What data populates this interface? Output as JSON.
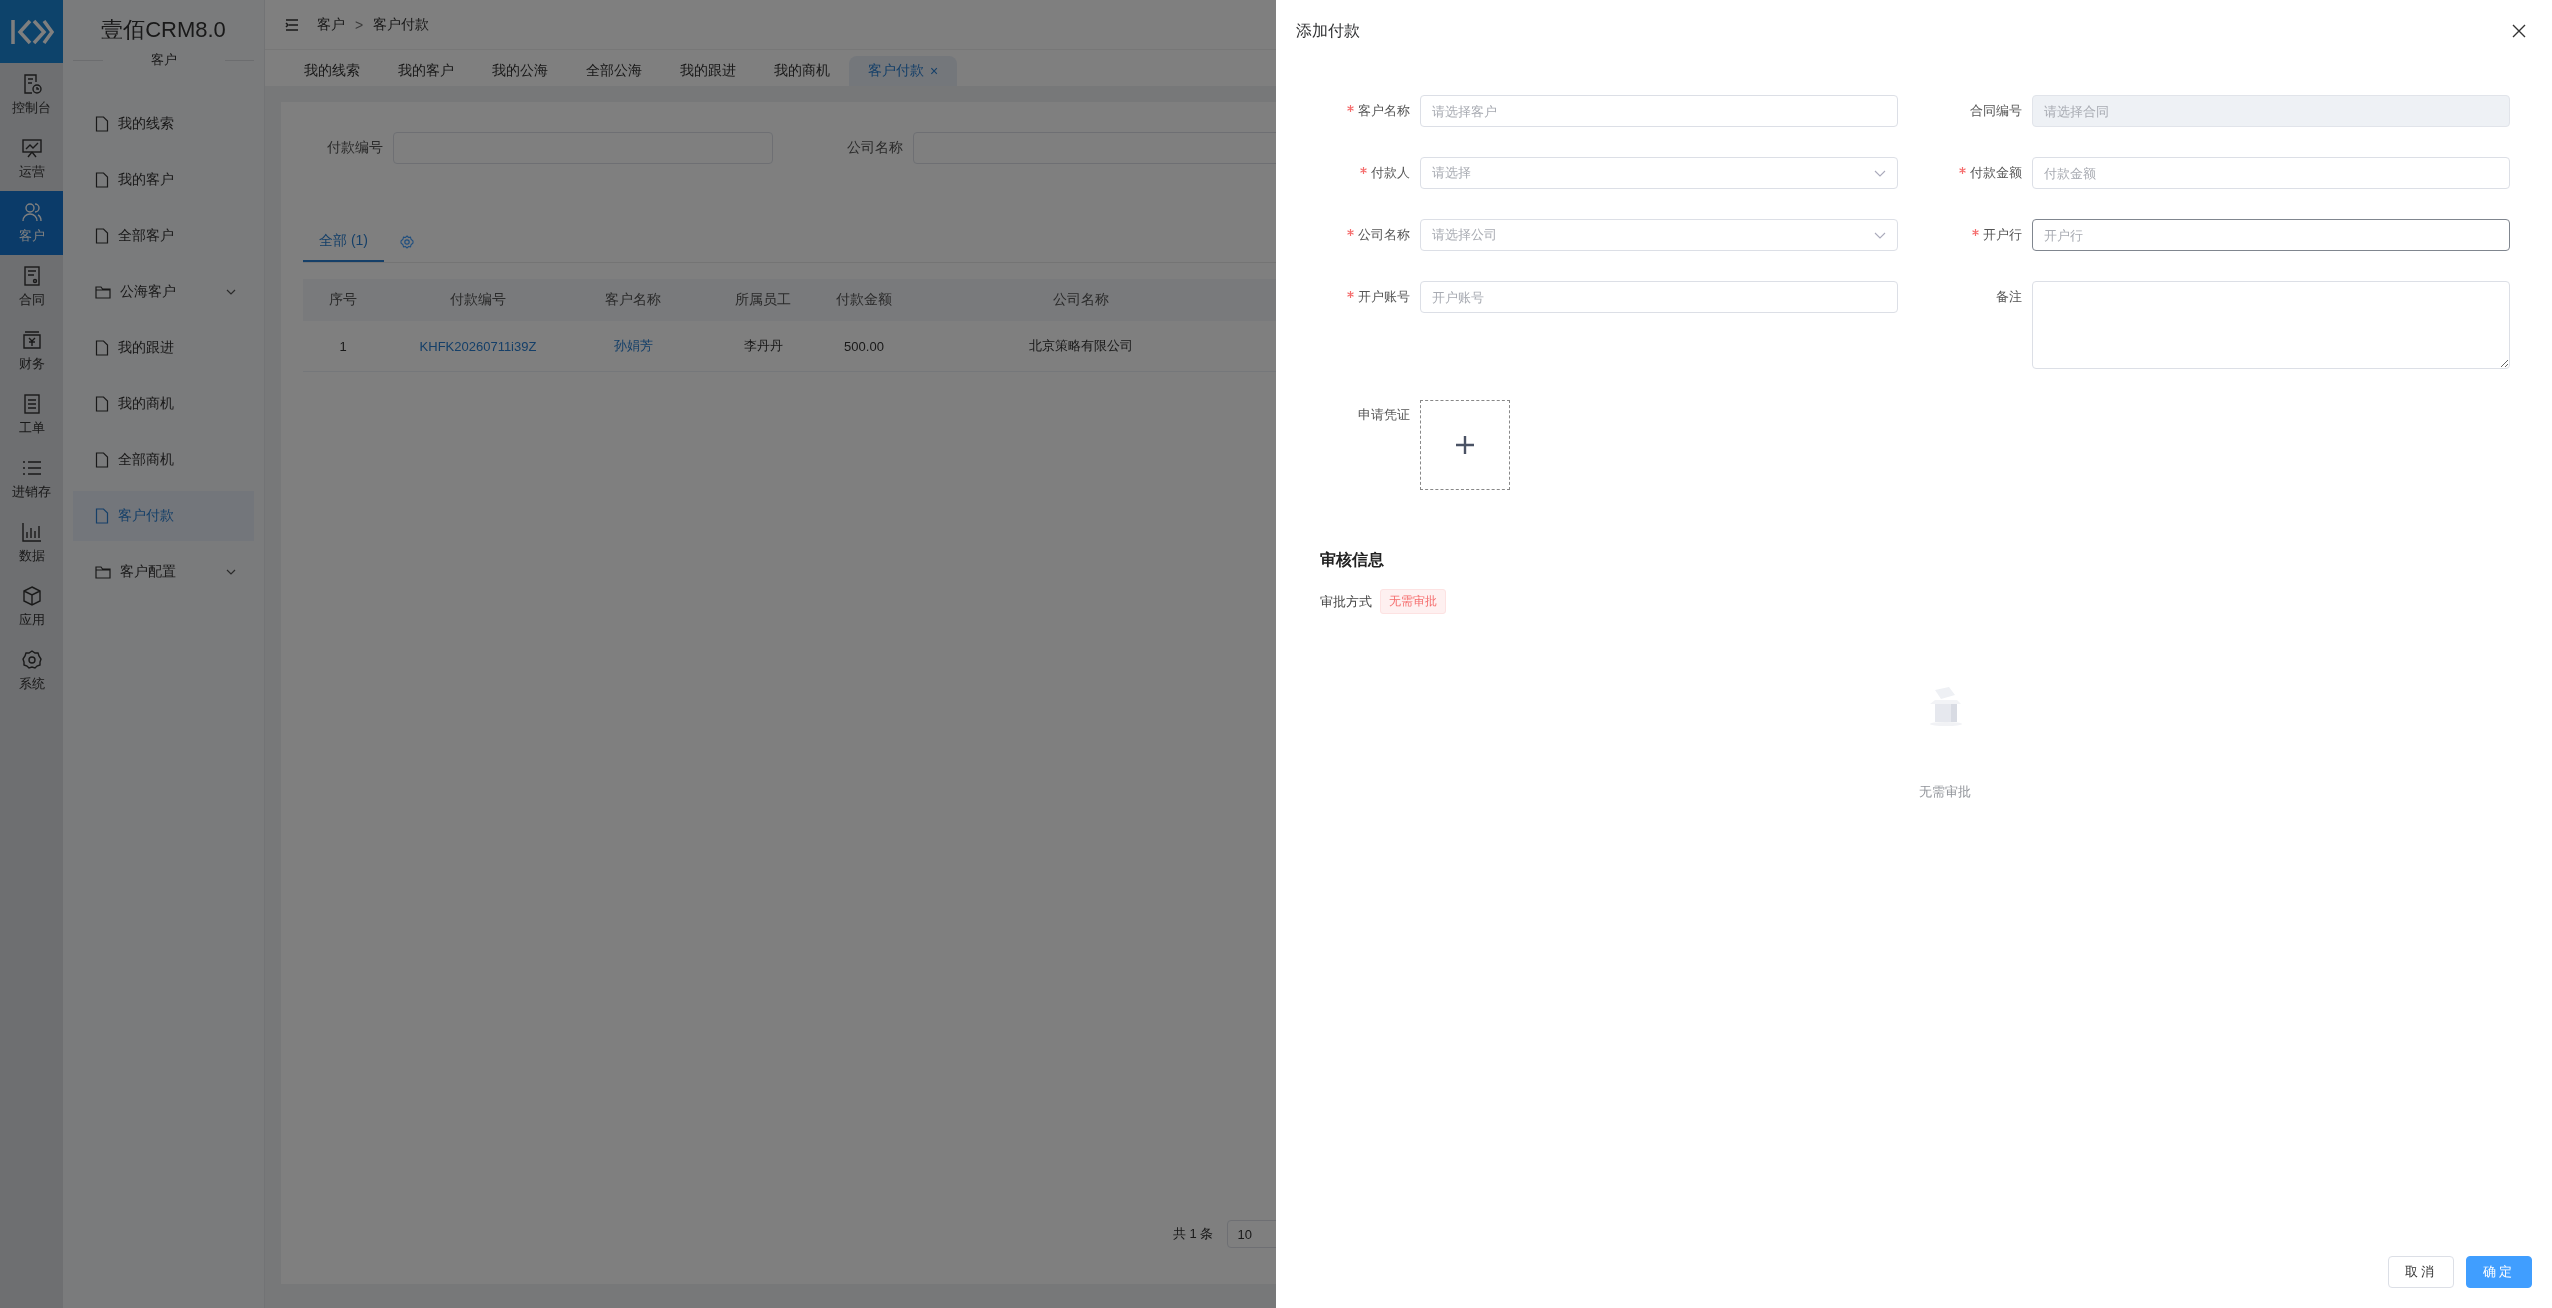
{
  "nav_rail": {
    "items": [
      {
        "label": "控制台",
        "kind": "dashboard",
        "selected": false
      },
      {
        "label": "运营",
        "kind": "presentation",
        "selected": false
      },
      {
        "label": "客户",
        "kind": "users",
        "selected": true
      },
      {
        "label": "合同",
        "kind": "contract",
        "selected": false
      },
      {
        "label": "财务",
        "kind": "finance",
        "selected": false
      },
      {
        "label": "工单",
        "kind": "clipboard",
        "selected": false
      },
      {
        "label": "进销存",
        "kind": "list",
        "selected": false
      },
      {
        "label": "数据",
        "kind": "chart",
        "selected": false
      },
      {
        "label": "应用",
        "kind": "cube",
        "selected": false
      },
      {
        "label": "系统",
        "kind": "gear",
        "selected": false
      }
    ]
  },
  "sidebar": {
    "title": "壹佰CRM8.0",
    "section": "客户",
    "items": [
      {
        "label": "我的线索",
        "kind": "page",
        "selected": false
      },
      {
        "label": "我的客户",
        "kind": "page",
        "selected": false
      },
      {
        "label": "全部客户",
        "kind": "page",
        "selected": false
      },
      {
        "label": "公海客户",
        "kind": "folder",
        "selected": false,
        "expanded": false
      },
      {
        "label": "我的跟进",
        "kind": "page",
        "selected": false
      },
      {
        "label": "我的商机",
        "kind": "page",
        "selected": false
      },
      {
        "label": "全部商机",
        "kind": "page",
        "selected": false
      },
      {
        "label": "客户付款",
        "kind": "page",
        "selected": true
      },
      {
        "label": "客户配置",
        "kind": "folder",
        "selected": false,
        "expanded": false
      }
    ]
  },
  "breadcrumb": {
    "items": [
      "客户",
      "客户付款"
    ],
    "separator": ">"
  },
  "tabs": [
    {
      "label": "我的线索",
      "selected": false
    },
    {
      "label": "我的客户",
      "selected": false
    },
    {
      "label": "我的公海",
      "selected": false
    },
    {
      "label": "全部公海",
      "selected": false
    },
    {
      "label": "我的跟进",
      "selected": false
    },
    {
      "label": "我的商机",
      "selected": false
    },
    {
      "label": "客户付款",
      "selected": true,
      "close": "×"
    }
  ],
  "filters": [
    {
      "label": "付款编号"
    },
    {
      "label": "公司名称"
    }
  ],
  "list_tabs": [
    {
      "label": "全部",
      "count": "(1)",
      "selected": true
    }
  ],
  "table": {
    "columns": [
      {
        "label": "序号",
        "kind": "text"
      },
      {
        "label": "付款编号",
        "kind": "link"
      },
      {
        "label": "客户名称",
        "kind": "link"
      },
      {
        "label": "所属员工",
        "kind": "text"
      },
      {
        "label": "付款金额",
        "kind": "text"
      },
      {
        "label": "公司名称",
        "kind": "text"
      }
    ],
    "rows": [
      {
        "cells": [
          "1",
          "KHFK20260711i39Z",
          "孙娟芳",
          "李丹丹",
          "500.00",
          "北京策略有限公司"
        ]
      }
    ]
  },
  "pagination": {
    "total": "共 1 条",
    "page_size": "10"
  },
  "drawer": {
    "title": "添加付款",
    "fields": [
      {
        "label": "客户名称",
        "required": true,
        "kind": "input",
        "placeholder": "请选择客户",
        "disabled": false,
        "focused": false
      },
      {
        "label": "合同编号",
        "required": false,
        "kind": "input",
        "placeholder": "请选择合同",
        "disabled": true,
        "focused": false
      },
      {
        "label": "付款人",
        "required": true,
        "kind": "select",
        "placeholder": "请选择",
        "disabled": false,
        "focused": false
      },
      {
        "label": "付款金额",
        "required": true,
        "kind": "input",
        "placeholder": "付款金额",
        "disabled": false,
        "focused": false
      },
      {
        "label": "公司名称",
        "required": true,
        "kind": "select",
        "placeholder": "请选择公司",
        "disabled": false,
        "focused": false
      },
      {
        "label": "开户行",
        "required": true,
        "kind": "input",
        "placeholder": "开户行",
        "disabled": false,
        "focused": true
      },
      {
        "label": "开户账号",
        "required": true,
        "kind": "input",
        "placeholder": "开户账号",
        "disabled": false,
        "focused": false
      },
      {
        "label": "备注",
        "required": false,
        "kind": "textarea",
        "disabled": false,
        "focused": false
      },
      {
        "label": "申请凭证",
        "required": false,
        "kind": "upload",
        "disabled": false,
        "focused": false
      }
    ],
    "audit": {
      "title": "审核信息",
      "method_label": "审批方式",
      "method_tag": "无需审批",
      "empty_text": "无需审批"
    },
    "buttons": [
      {
        "label": "取消",
        "primary": false
      },
      {
        "label": "确定",
        "primary": true
      }
    ]
  }
}
